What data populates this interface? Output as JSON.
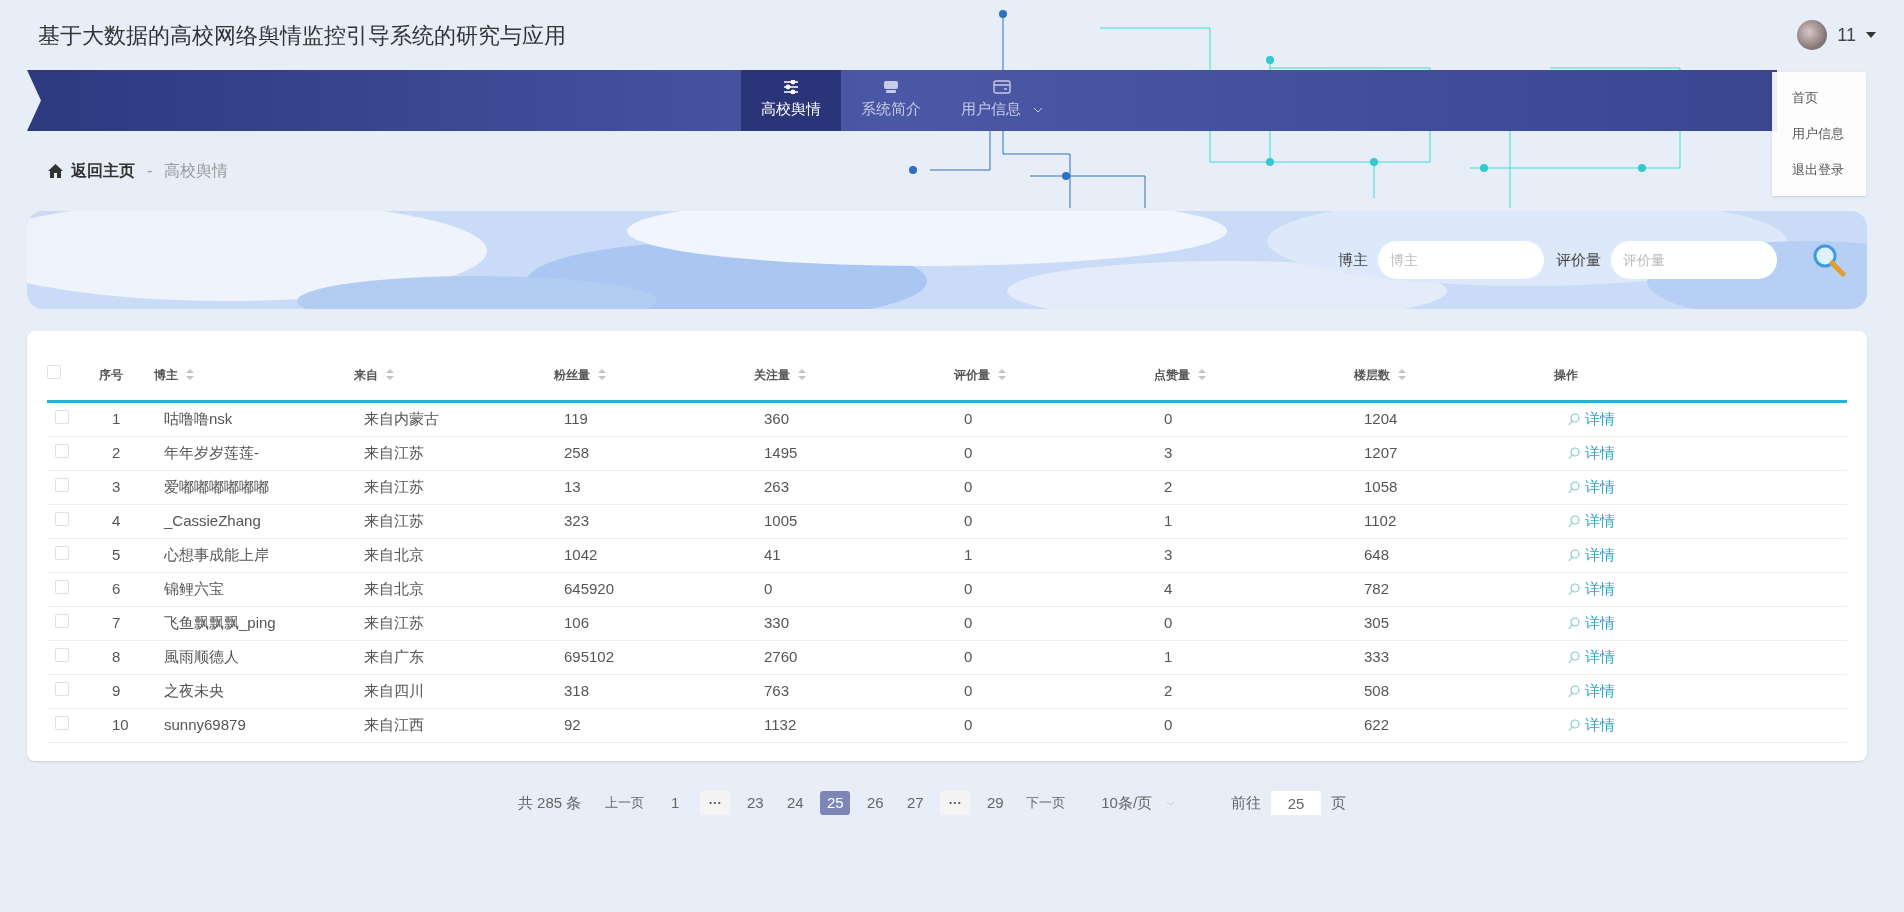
{
  "header": {
    "title": "基于大数据的高校网络舆情监控引导系统的研究与应用",
    "user": {
      "name": "11"
    }
  },
  "user_menu": [
    {
      "label": "首页"
    },
    {
      "label": "用户信息"
    },
    {
      "label": "退出登录"
    }
  ],
  "nav": [
    {
      "label": "高校舆情",
      "kind": "link",
      "selected": true
    },
    {
      "label": "系统简介",
      "kind": "link",
      "selected": false
    },
    {
      "label": "用户信息",
      "kind": "dropdown",
      "selected": false
    }
  ],
  "breadcrumb": {
    "home": "返回主页",
    "separator": "-",
    "current": "高校舆情"
  },
  "search": {
    "fields": [
      {
        "label": "博主",
        "placeholder": "博主"
      },
      {
        "label": "评价量",
        "placeholder": "评价量"
      }
    ]
  },
  "table": {
    "columns": [
      {
        "label": "序号",
        "sortable": false
      },
      {
        "label": "博主",
        "sortable": true
      },
      {
        "label": "来自",
        "sortable": true
      },
      {
        "label": "粉丝量",
        "sortable": true
      },
      {
        "label": "关注量",
        "sortable": true
      },
      {
        "label": "评价量",
        "sortable": true
      },
      {
        "label": "点赞量",
        "sortable": true
      },
      {
        "label": "楼层数",
        "sortable": true
      },
      {
        "label": "操作",
        "sortable": false
      }
    ],
    "select_all": {
      "checked": false
    },
    "rows": [
      {
        "checked": false,
        "cells": [
          "1",
          "咕噜噜nsk",
          "来自内蒙古",
          "119",
          "360",
          "0",
          "0",
          "1204"
        ],
        "action": "详情"
      },
      {
        "checked": false,
        "cells": [
          "2",
          "年年岁岁莲莲-",
          "来自江苏",
          "258",
          "1495",
          "0",
          "3",
          "1207"
        ],
        "action": "详情"
      },
      {
        "checked": false,
        "cells": [
          "3",
          "爱嘟嘟嘟嘟嘟嘟",
          "来自江苏",
          "13",
          "263",
          "0",
          "2",
          "1058"
        ],
        "action": "详情"
      },
      {
        "checked": false,
        "cells": [
          "4",
          "_CassieZhang",
          "来自江苏",
          "323",
          "1005",
          "0",
          "1",
          "1102"
        ],
        "action": "详情"
      },
      {
        "checked": false,
        "cells": [
          "5",
          "心想事成能上岸",
          "来自北京",
          "1042",
          "41",
          "1",
          "3",
          "648"
        ],
        "action": "详情"
      },
      {
        "checked": false,
        "cells": [
          "6",
          "锦鲤六宝",
          "来自北京",
          "645920",
          "0",
          "0",
          "4",
          "782"
        ],
        "action": "详情"
      },
      {
        "checked": false,
        "cells": [
          "7",
          "飞鱼飘飘飘_ping",
          "来自江苏",
          "106",
          "330",
          "0",
          "0",
          "305"
        ],
        "action": "详情"
      },
      {
        "checked": false,
        "cells": [
          "8",
          "風雨顺德人",
          "来自广东",
          "695102",
          "2760",
          "0",
          "1",
          "333"
        ],
        "action": "详情"
      },
      {
        "checked": false,
        "cells": [
          "9",
          "之夜未央",
          "来自四川",
          "318",
          "763",
          "0",
          "2",
          "508"
        ],
        "action": "详情"
      },
      {
        "checked": false,
        "cells": [
          "10",
          "sunny69879",
          "来自江西",
          "92",
          "1132",
          "0",
          "0",
          "622"
        ],
        "action": "详情"
      }
    ]
  },
  "pagination": {
    "total": "共 285 条",
    "prev": "上一页",
    "pages": [
      {
        "kind": "page",
        "label": "1",
        "selected": false
      },
      {
        "kind": "ellipsis",
        "label": "···",
        "selected": false
      },
      {
        "kind": "page",
        "label": "23",
        "selected": false
      },
      {
        "kind": "page",
        "label": "24",
        "selected": false
      },
      {
        "kind": "page",
        "label": "25",
        "selected": true
      },
      {
        "kind": "page",
        "label": "26",
        "selected": false
      },
      {
        "kind": "page",
        "label": "27",
        "selected": false
      },
      {
        "kind": "ellipsis",
        "label": "···",
        "selected": false
      },
      {
        "kind": "page",
        "label": "29",
        "selected": false
      }
    ],
    "next": "下一页",
    "page_size": "10条/页",
    "goto_label": "前往",
    "goto_value": "25",
    "goto_suffix": "页"
  }
}
